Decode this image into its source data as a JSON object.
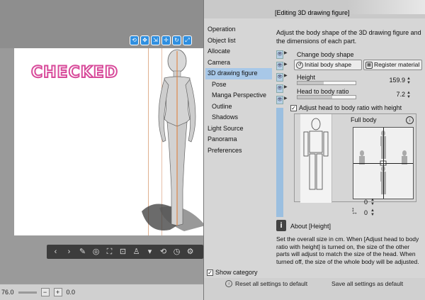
{
  "gizmo_icons": [
    "camera-icon",
    "camera-icon",
    "camera-icon",
    "move-icon",
    "rotate-icon",
    "scale-icon"
  ],
  "canvas": {
    "watermark_text": "CHECKED"
  },
  "bottom_toolbar": {
    "items": [
      "chevron-left-icon",
      "chevron-right-icon",
      "wrench-icon",
      "camera-icon",
      "frame-icon",
      "landing-icon",
      "pose-icon",
      "dropdown-icon",
      "undo-icon",
      "clock-icon",
      "settings-icon"
    ]
  },
  "statusbar": {
    "zoom": "76.0",
    "rotation": "0.0"
  },
  "panel": {
    "title": "[Editing 3D drawing figure]",
    "categories": [
      {
        "label": "Operation",
        "sub": false,
        "selected": false
      },
      {
        "label": "Object list",
        "sub": false,
        "selected": false
      },
      {
        "label": "Allocate",
        "sub": false,
        "selected": false
      },
      {
        "label": "Camera",
        "sub": false,
        "selected": false
      },
      {
        "label": "3D drawing figure",
        "sub": false,
        "selected": true
      },
      {
        "label": "Pose",
        "sub": true,
        "selected": false
      },
      {
        "label": "Manga Perspective",
        "sub": true,
        "selected": false
      },
      {
        "label": "Outline",
        "sub": true,
        "selected": false
      },
      {
        "label": "Shadows",
        "sub": true,
        "selected": false
      },
      {
        "label": "Light Source",
        "sub": false,
        "selected": false
      },
      {
        "label": "Panorama",
        "sub": false,
        "selected": false
      },
      {
        "label": "Preferences",
        "sub": false,
        "selected": false
      }
    ],
    "show_category": "Show category",
    "description": "Adjust the body shape of the 3D drawing figure and the dimensions of each part.",
    "change_body_shape": "Change body shape",
    "initial_body_shape": "Initial body shape",
    "register_material": "Register material",
    "height_label": "Height",
    "height_value": "159.9",
    "height_fraction": 0.45,
    "head_ratio_label": "Head to body ratio",
    "head_ratio_value": "7.2",
    "head_ratio_fraction": 0.6,
    "adjust_checkbox": "Adjust head to body ratio with height",
    "full_body_label": "Full body",
    "offset_v_value": "0",
    "offset_h_value": "0",
    "about_title": "About [Height]",
    "about_body": "Set the overall size in cm. When [Adjust head to body ratio with height] is turned on, the size of the other parts will adjust to match the size of the head. When turned off, the size of the whole body will be adjusted.",
    "reset_all": "Reset all settings to default",
    "save_all": "Save all settings as default"
  }
}
